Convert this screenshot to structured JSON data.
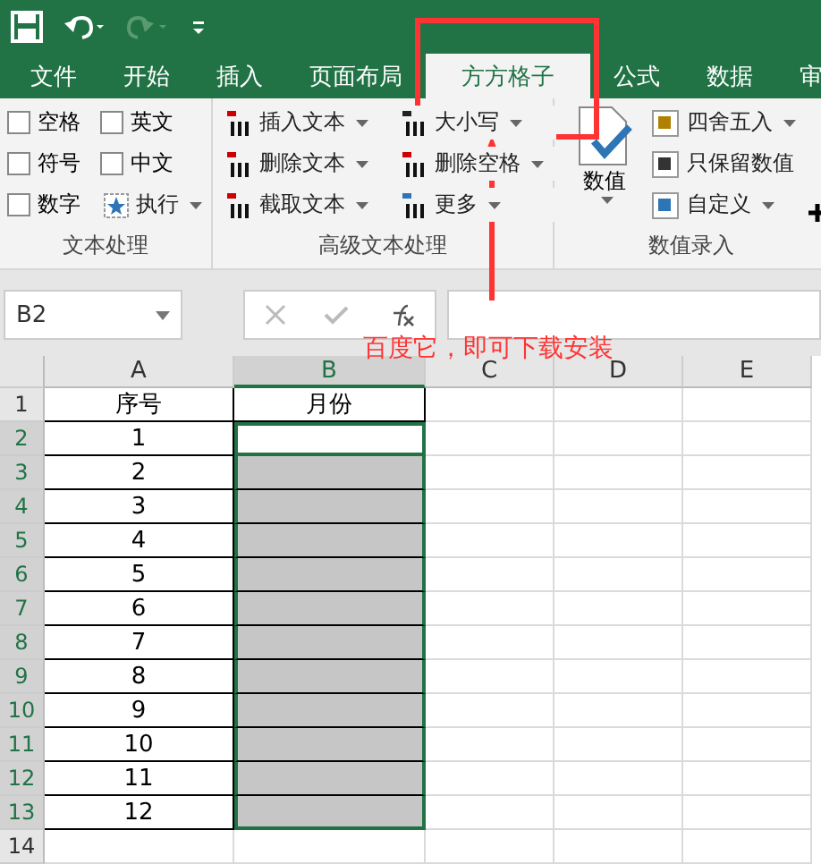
{
  "tabs": [
    {
      "label": "文件",
      "selected": false
    },
    {
      "label": "开始",
      "selected": false
    },
    {
      "label": "插入",
      "selected": false
    },
    {
      "label": "页面布局",
      "selected": false
    },
    {
      "label": "方方格子",
      "selected": true
    },
    {
      "label": "公式",
      "selected": false
    },
    {
      "label": "数据",
      "selected": false
    },
    {
      "label": "审",
      "selected": false
    }
  ],
  "ribbon": {
    "groups": [
      {
        "label": "文本处理",
        "checkboxes": [
          {
            "label": "空格",
            "checked": false
          },
          {
            "label": "英文",
            "checked": false
          },
          {
            "label": "符号",
            "checked": false
          },
          {
            "label": "中文",
            "checked": false
          },
          {
            "label": "数字",
            "checked": false
          }
        ],
        "run": "执行"
      },
      {
        "label": "高级文本处理",
        "commands": [
          {
            "label": "插入文本",
            "kind": "insert"
          },
          {
            "label": "大小写",
            "kind": "case"
          },
          {
            "label": "删除文本",
            "kind": "delete"
          },
          {
            "label": "删除空格",
            "kind": "space"
          },
          {
            "label": "截取文本",
            "kind": "cut"
          },
          {
            "label": "更多",
            "kind": "more"
          }
        ]
      },
      {
        "label": "数值录入",
        "big": "数值",
        "commands": [
          {
            "label": "四舍五入",
            "kind": "round"
          },
          {
            "label": "只保留数值",
            "kind": "keep"
          },
          {
            "label": "自定义",
            "kind": "custom"
          }
        ]
      }
    ]
  },
  "formula_bar": {
    "name_box": "B2"
  },
  "annotation": {
    "text": "百度它，即可下载安装"
  },
  "columns": [
    {
      "label": "A",
      "selected": false
    },
    {
      "label": "B",
      "selected": true
    },
    {
      "label": "C",
      "selected": false
    },
    {
      "label": "D",
      "selected": false
    },
    {
      "label": "E",
      "selected": false
    }
  ],
  "rows": [
    {
      "num": "1",
      "a": "序号",
      "b": "月份",
      "selected": false,
      "active": false
    },
    {
      "num": "2",
      "a": "1",
      "selected": true,
      "active": true
    },
    {
      "num": "3",
      "a": "2",
      "selected": true,
      "active": false
    },
    {
      "num": "4",
      "a": "3",
      "selected": true,
      "active": false
    },
    {
      "num": "5",
      "a": "4",
      "selected": true,
      "active": false
    },
    {
      "num": "6",
      "a": "5",
      "selected": true,
      "active": false
    },
    {
      "num": "7",
      "a": "6",
      "selected": true,
      "active": false
    },
    {
      "num": "8",
      "a": "7",
      "selected": true,
      "active": false
    },
    {
      "num": "9",
      "a": "8",
      "selected": true,
      "active": false
    },
    {
      "num": "10",
      "a": "9",
      "selected": true,
      "active": false
    },
    {
      "num": "11",
      "a": "10",
      "selected": true,
      "active": false
    },
    {
      "num": "12",
      "a": "11",
      "selected": true,
      "active": false
    },
    {
      "num": "13",
      "a": "12",
      "selected": true,
      "active": false
    },
    {
      "num": "14",
      "selected": false,
      "active": false
    }
  ]
}
